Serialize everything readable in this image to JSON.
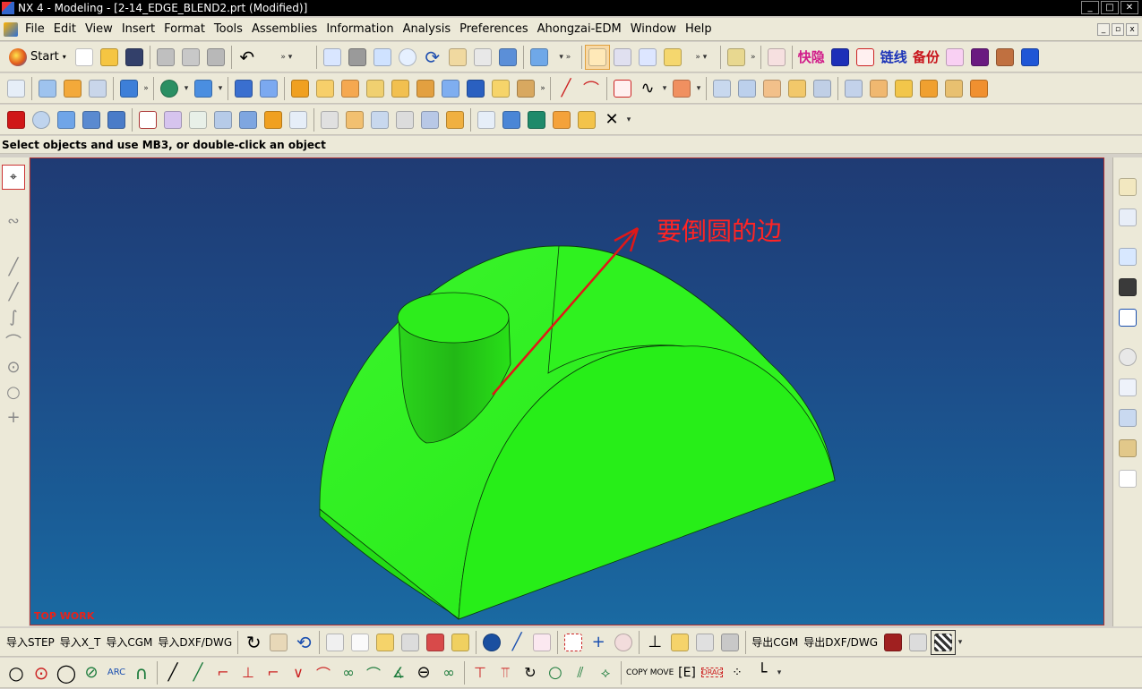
{
  "window": {
    "title": "NX 4 - Modeling - [2-14_EDGE_BLEND2.prt (Modified)]",
    "min": "_",
    "max": "□",
    "close": "✕"
  },
  "menu": [
    "File",
    "Edit",
    "View",
    "Insert",
    "Format",
    "Tools",
    "Assemblies",
    "Information",
    "Analysis",
    "Preferences",
    "Ahongzai-EDM",
    "Window",
    "Help"
  ],
  "toolbar1": {
    "start_label": "Start",
    "chinese_buttons": [
      "快隐",
      "链线",
      "备份"
    ]
  },
  "status": {
    "text": "Select objects and use MB3, or double-click an object"
  },
  "graphics": {
    "view_name": "TOP WORK",
    "annotation": "要倒圆的边",
    "colors": {
      "background_top": "#1f3b74",
      "background_bottom": "#1a6aa2",
      "part": "#27ee18",
      "annotation": "#ff2424"
    }
  },
  "bottom_toolbar": {
    "text_buttons": [
      "导入STEP",
      "导入X_T",
      "导入CGM",
      "导入DXF/DWG",
      "导出CGM",
      "导出DXF/DWG"
    ]
  }
}
